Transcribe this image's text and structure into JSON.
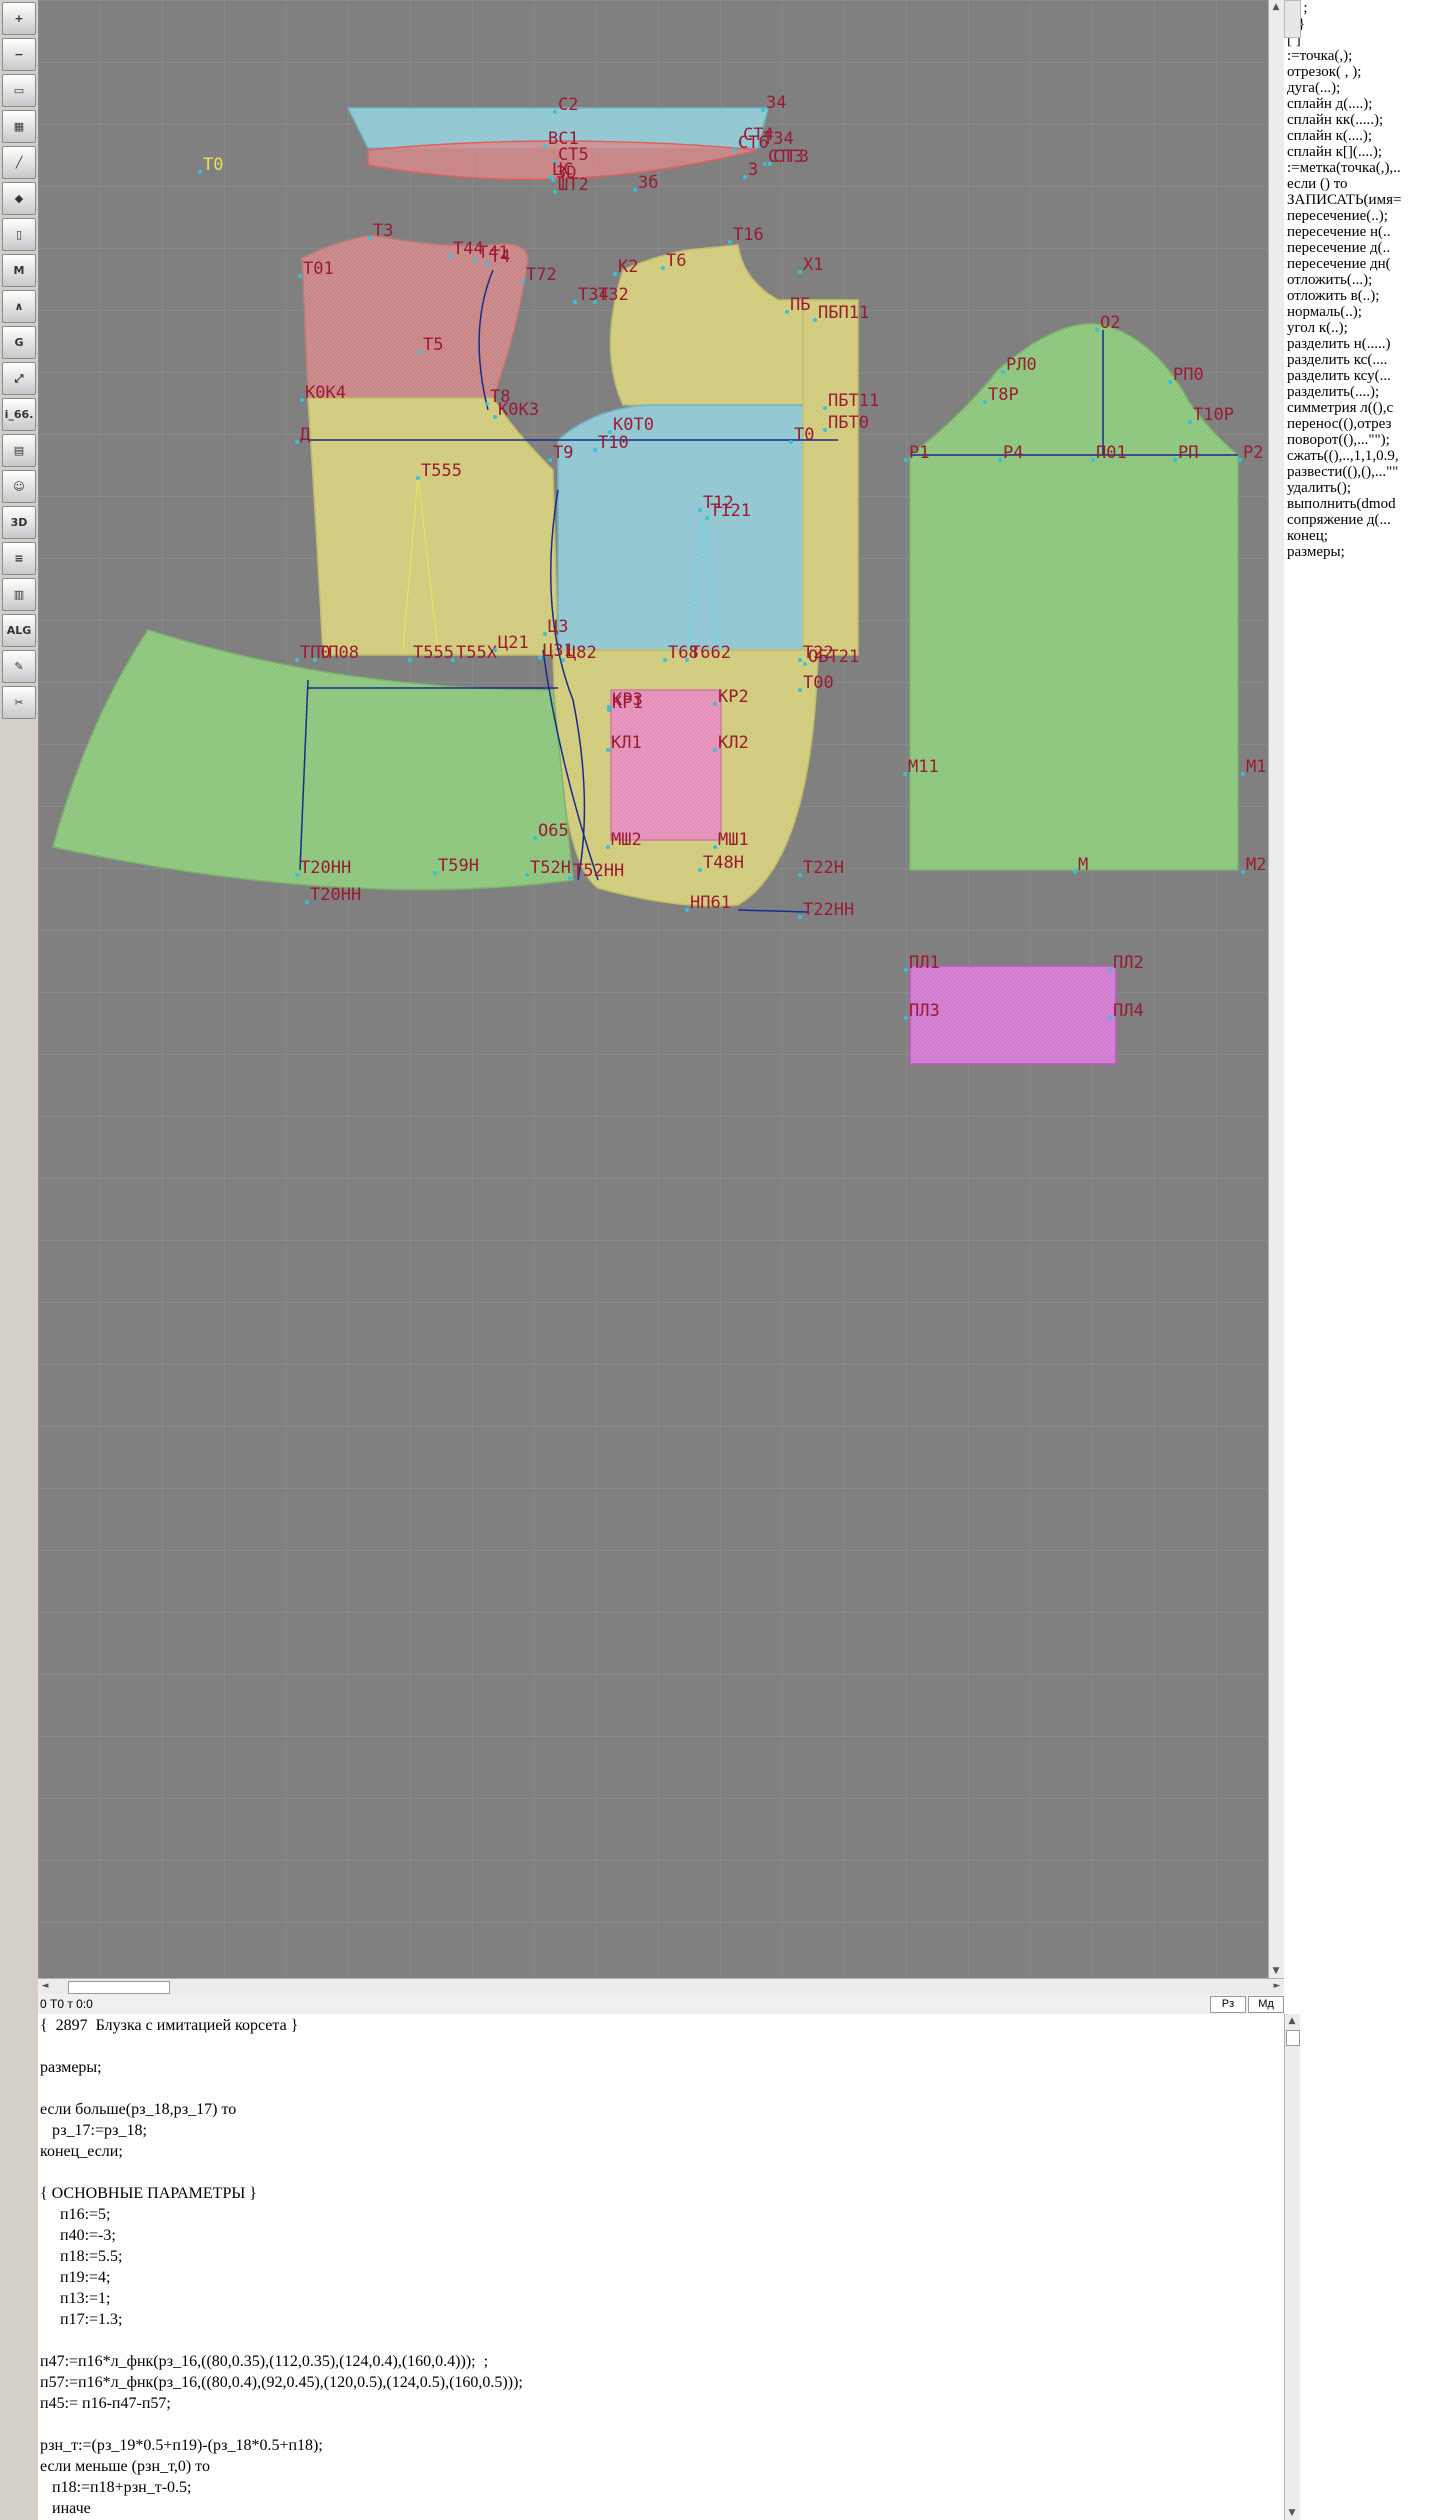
{
  "toolbar": {
    "tools": [
      {
        "name": "zoom-in-icon",
        "glyph": "+"
      },
      {
        "name": "zoom-out-icon",
        "glyph": "−"
      },
      {
        "name": "pattern-icon",
        "glyph": "▭"
      },
      {
        "name": "grid-icon",
        "glyph": "▦"
      },
      {
        "name": "line-tool-icon",
        "glyph": "╱"
      },
      {
        "name": "layer-icon",
        "glyph": "◆"
      },
      {
        "name": "piece-icon",
        "glyph": "▯"
      },
      {
        "name": "m-tool-icon",
        "glyph": "M"
      },
      {
        "name": "measure-icon",
        "glyph": "∧"
      },
      {
        "name": "g-tool-icon",
        "glyph": "G"
      },
      {
        "name": "transform-icon",
        "glyph": "⤢"
      },
      {
        "name": "model-label-icon",
        "glyph": "i_66."
      },
      {
        "name": "sheet-icon",
        "glyph": "▤"
      },
      {
        "name": "mannequin-icon",
        "glyph": "☺"
      },
      {
        "name": "3d-view-icon",
        "glyph": "3D"
      },
      {
        "name": "layers-stack-icon",
        "glyph": "≡"
      },
      {
        "name": "print-icon",
        "glyph": "▥"
      },
      {
        "name": "alg-icon",
        "glyph": "ALG"
      },
      {
        "name": "pen-icon",
        "glyph": "✎"
      },
      {
        "name": "cut-icon",
        "glyph": "✂"
      }
    ]
  },
  "canvas": {
    "labels": [
      "С2",
      "34",
      "Т0",
      "СТ5",
      "ВС1",
      "Т34",
      "СТ4",
      "СТ3",
      "СТ6",
      "СТГ3",
      "ЦС",
      "3D",
      "ШТ2",
      "3б",
      "3",
      "Т3",
      "Т44",
      "Т41",
      "Т4",
      "Т72",
      "Т01",
      "К2",
      "Т6",
      "Т16",
      "Х1",
      "Т5",
      "ПБ",
      "ПБП11",
      "ТЗ4",
      "ТЗ2",
      "К0К4",
      "Т8",
      "К0К3",
      "Т0",
      "ПБТ0",
      "ПБТ11",
      "Д",
      "Т9",
      "Т10",
      "К0Т0",
      "Т555",
      "Т12",
      "Т121",
      "ТП0",
      "ТП08",
      "Т555",
      "Т55Х",
      "Ц21",
      "Ц31",
      "Ц82",
      "Т68",
      "Т662",
      "ОБТ21",
      "Т22",
      "Т00",
      "Ц3",
      "КР1",
      "КР2",
      "КР3",
      "КЛ1",
      "КЛ2",
      "Т20НН",
      "Т20НН",
      "Т59Н",
      "Т52Н",
      "Т52НН",
      "О65",
      "МШ2",
      "МШ1",
      "Т48Н",
      "Т22Н",
      "НП61",
      "Т22НН",
      "О2",
      "РЛ0",
      "РП0",
      "Т8Р",
      "Т10Р",
      "Р1",
      "Р4",
      "П01",
      "РП",
      "Р2",
      "М11",
      "М1",
      "М",
      "М2",
      "ПЛ1",
      "ПЛ2",
      "ПЛ3",
      "ПЛ4"
    ]
  },
  "scrollbars": {
    "left_arrow": "◄",
    "right_arrow": "►",
    "up_arrow": "▲",
    "down_arrow": "▼"
  },
  "status": {
    "text": "0  Т0 т 0:0",
    "rz_button": "Рз",
    "md_button": "Мд"
  },
  "commands": [
    ":= ;",
    "{  }",
    "[ ]",
    ":=точка(,);",
    "отрезок( , );",
    "дуга(...);",
    "сплайн  д(....);",
    "сплайн  кк(.....);",
    "сплайн  к(....);",
    "сплайн  к[](....);",
    ":=метка(точка(,),..",
    "если () то",
    "ЗАПИСАТЬ(имя=",
    "пересечение(..);",
    "пересечение  н(..",
    "пересечение  д(..",
    "пересечение  дн(",
    "отложить(...);",
    "отложить  в(..);",
    "нормаль(..);",
    "угол  к(..);",
    "разделить  н(.....)",
    "разделить  кс(....",
    "разделить  ксу(...",
    "разделить(....);",
    "симметрия  л((),с",
    "перенос((),отрез",
    "поворот((),...\"\");",
    "сжать((),..,1,1,0.9,",
    "развести((),(),...\"\"",
    "удалить();",
    "выполнить(dmod",
    "сопряжение  д(...",
    "конец;",
    "размеры;"
  ],
  "editor": {
    "lines": [
      "{  2897  Блузка с имитацией корсета }",
      "",
      "размеры;",
      "",
      "если больше(рз_18,рз_17) то",
      "   рз_17:=рз_18;",
      "конец_если;",
      "",
      "{ ОСНОВНЫЕ ПАРАМЕТРЫ }",
      "     п16:=5;",
      "     п40:=-3;",
      "     п18:=5.5;",
      "     п19:=4;",
      "     п13:=1;",
      "     п17:=1.3;",
      "",
      "п47:=п16*л_фнк(рз_16,((80,0.35),(112,0.35),(124,0.4),(160,0.4)));  ;",
      "п57:=п16*л_фнк(рз_16,((80,0.4),(92,0.45),(120,0.5),(124,0.5),(160,0.5)));",
      "п45:= п16-п47-п57;",
      "",
      "рзн_т:=(рз_19*0.5+п19)-(рз_18*0.5+п18);",
      "если меньше (рзн_т,0) то",
      "   п18:=п18+рзн_т-0.5;",
      "   иначе"
    ]
  }
}
